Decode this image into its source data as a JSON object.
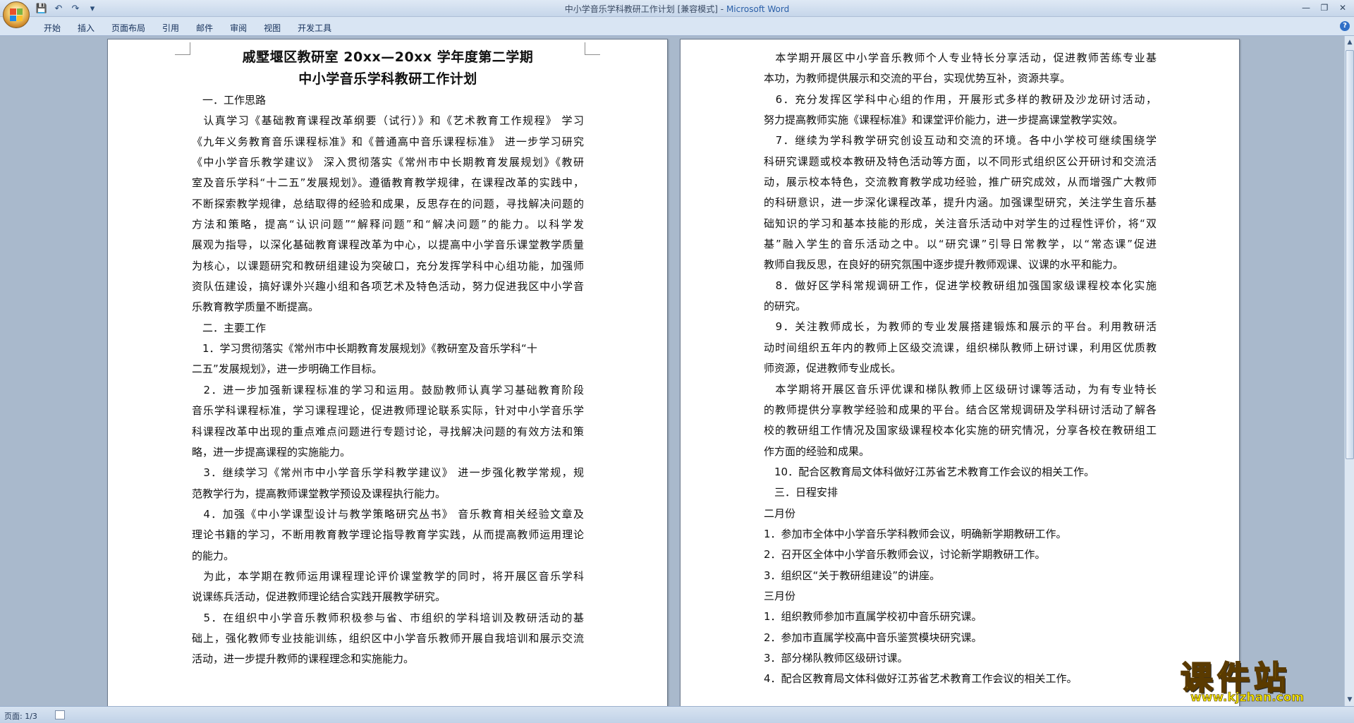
{
  "window": {
    "title_doc": "中小学音乐学科教研工作计划 [兼容模式]",
    "title_sep": " - ",
    "title_app": "Microsoft Word"
  },
  "qat": {
    "save": "💾",
    "undo": "↶",
    "redo": "↷",
    "more": "▾"
  },
  "win_controls": {
    "minimize": "—",
    "restore": "❐",
    "close": "✕"
  },
  "ribbon": {
    "tabs": [
      "开始",
      "插入",
      "页面布局",
      "引用",
      "邮件",
      "审阅",
      "视图",
      "开发工具"
    ],
    "help": "?"
  },
  "page1": {
    "title_lines": [
      "戚墅堰区教研室 20xx—20xx 学年度第二学期",
      "中小学音乐学科教研工作计划"
    ],
    "lines": [
      "　一．工作思路",
      "　认真学习《基础教育课程改革纲要（试行）》和《艺术教育工作规程》 学习",
      "《九年义务教育音乐课程标准》和《普通高中音乐课程标准》 进一步学习研究",
      "《中小学音乐教学建议》 深入贯彻落实《常州市中长期教育发展规划》《教研",
      "室及音乐学科“十二五”发展规划》。遵循教育教学规律，在课程改革的实践中，",
      "不断探索教学规律，总结取得的经验和成果，反思存在的问题，寻找解决问题的",
      "方法和策略，提高“认识问题”“解释问题”和“解决问题”的能力。以科学发",
      "展观为指导，以深化基础教育课程改革为中心，以提高中小学音乐课堂教学质量",
      "为核心，以课题研究和教研组建设为突破口，充分发挥学科中心组功能，加强师",
      "资队伍建设，搞好课外兴趣小组和各项艺术及特色活动，努力促进我区中小学音",
      "乐教育教学质量不断提高。",
      "　二．主要工作",
      "　1．学习贯彻落实《常州市中长期教育发展规划》《教研室及音乐学科“十",
      "二五”发展规划》，进一步明确工作目标。",
      "　2．进一步加强新课程标准的学习和运用。鼓励教师认真学习基础教育阶段",
      "音乐学科课程标准，学习课程理论，促进教师理论联系实际，针对中小学音乐学",
      "科课程改革中出现的重点难点问题进行专题讨论，寻找解决问题的有效方法和策",
      "略，进一步提高课程的实施能力。",
      "　3．继续学习《常州市中小学音乐学科教学建议》 进一步强化教学常规，规",
      "范教学行为，提高教师课堂教学预设及课程执行能力。",
      "　4．加强《中小学课型设计与教学策略研究丛书》 音乐教育相关经验文章及",
      "理论书籍的学习，不断用教育教学理论指导教育学实践，从而提高教师运用理论",
      "的能力。",
      "　为此，本学期在教师运用课程理论评价课堂教学的同时，将开展区音乐学科",
      "说课练兵活动，促进教师理论结合实践开展教学研究。",
      "　5．在组织中小学音乐教师积极参与省、市组织的学科培训及教研活动的基",
      "础上，强化教师专业技能训练，组织区中小学音乐教师开展自我培训和展示交流",
      "活动，进一步提升教师的课程理念和实施能力。"
    ]
  },
  "page2": {
    "lines": [
      "　本学期开展区中小学音乐教师个人专业特长分享活动，促进教师苦练专业基",
      "本功，为教师提供展示和交流的平台，实现优势互补，资源共享。",
      "　6．充分发挥区学科中心组的作用，开展形式多样的教研及沙龙研讨活动，",
      "努力提高教师实施《课程标准》和课堂评价能力，进一步提高课堂教学实效。",
      "　7．继续为学科教学研究创设互动和交流的环境。各中小学校可继续围绕学",
      "科研究课题或校本教研及特色活动等方面，以不同形式组织区公开研讨和交流活",
      "动，展示校本特色，交流教育教学成功经验，推广研究成效，从而增强广大教师",
      "的科研意识，进一步深化课程改革，提升内涵。加强课型研究，关注学生音乐基",
      "础知识的学习和基本技能的形成，关注音乐活动中对学生的过程性评价，将“双",
      "基”融入学生的音乐活动之中。以“研究课”引导日常教学，以“常态课”促进",
      "教师自我反思，在良好的研究氛围中逐步提升教师观课、议课的水平和能力。",
      "　8．做好区学科常规调研工作，促进学校教研组加强国家级课程校本化实施",
      "的研究。",
      "　9．关注教师成长，为教师的专业发展搭建锻炼和展示的平台。利用教研活",
      "动时间组织五年内的教师上区级交流课，组织梯队教师上研讨课，利用区优质教",
      "师资源，促进教师专业成长。",
      "　本学期将开展区音乐评优课和梯队教师上区级研讨课等活动，为有专业特长",
      "的教师提供分享教学经验和成果的平台。结合区常规调研及学科研讨活动了解各",
      "校的教研组工作情况及国家级课程校本化实施的研究情况，分享各校在教研组工",
      "作方面的经验和成果。",
      "　10．配合区教育局文体科做好江苏省艺术教育工作会议的相关工作。",
      "　三．日程安排",
      "二月份",
      "1．参加市全体中小学音乐学科教师会议，明确新学期教研工作。",
      "2．召开区全体中小学音乐教师会议，讨论新学期教研工作。",
      "3．组织区“关于教研组建设”的讲座。",
      "三月份",
      "1．组织教师参加市直属学校初中音乐研究课。",
      "2．参加市直属学校高中音乐鉴赏模块研究课。",
      "3．部分梯队教师区级研讨课。",
      "4．配合区教育局文体科做好江苏省艺术教育工作会议的相关工作。"
    ]
  },
  "status": {
    "page": "页面: 1/3"
  },
  "watermark": {
    "text": "课件站",
    "url": "www.kjzhan.com"
  }
}
